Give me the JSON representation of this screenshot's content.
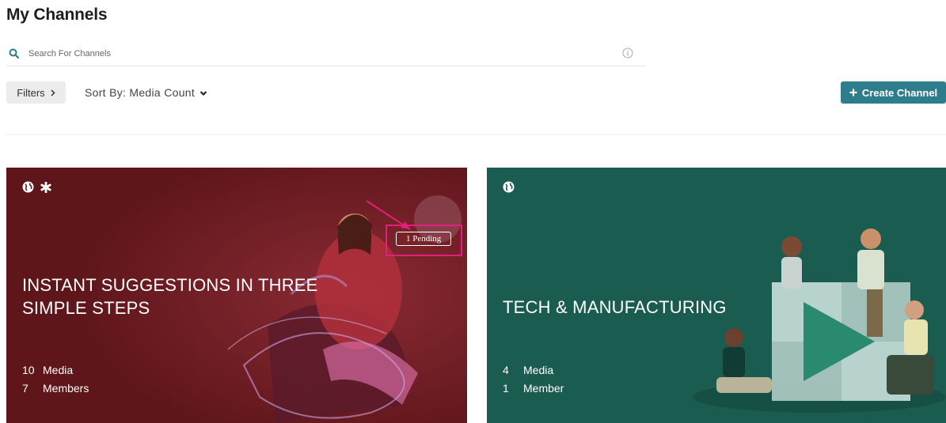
{
  "page": {
    "title": "My Channels"
  },
  "search": {
    "placeholder": "Search For Channels",
    "value": "",
    "icon": "search-icon",
    "info_icon": "info-icon"
  },
  "toolbar": {
    "filters_label": "Filters",
    "filters_icon": "chevron-right-icon",
    "sort_label": "Sort By: Media Count",
    "sort_icon": "chevron-down-icon",
    "create_label": "Create Channel",
    "create_icon": "plus-icon",
    "accent_color": "#2e7d8c"
  },
  "channels": [
    {
      "title": "INSTANT SUGGESTIONS IN THREE SIMPLE STEPS",
      "icons": [
        "globe-icon",
        "asterisk-icon"
      ],
      "pending_label": "1 Pending",
      "media_count": "10",
      "media_label": "Media",
      "members_count": "7",
      "members_label": "Members",
      "background_color": "#6f1d22"
    },
    {
      "title": "TECH & MANUFACTURING",
      "icons": [
        "globe-icon"
      ],
      "media_count": "4",
      "media_label": "Media",
      "members_count": "1",
      "members_label": "Member",
      "background_color": "#1a5c4f"
    }
  ]
}
